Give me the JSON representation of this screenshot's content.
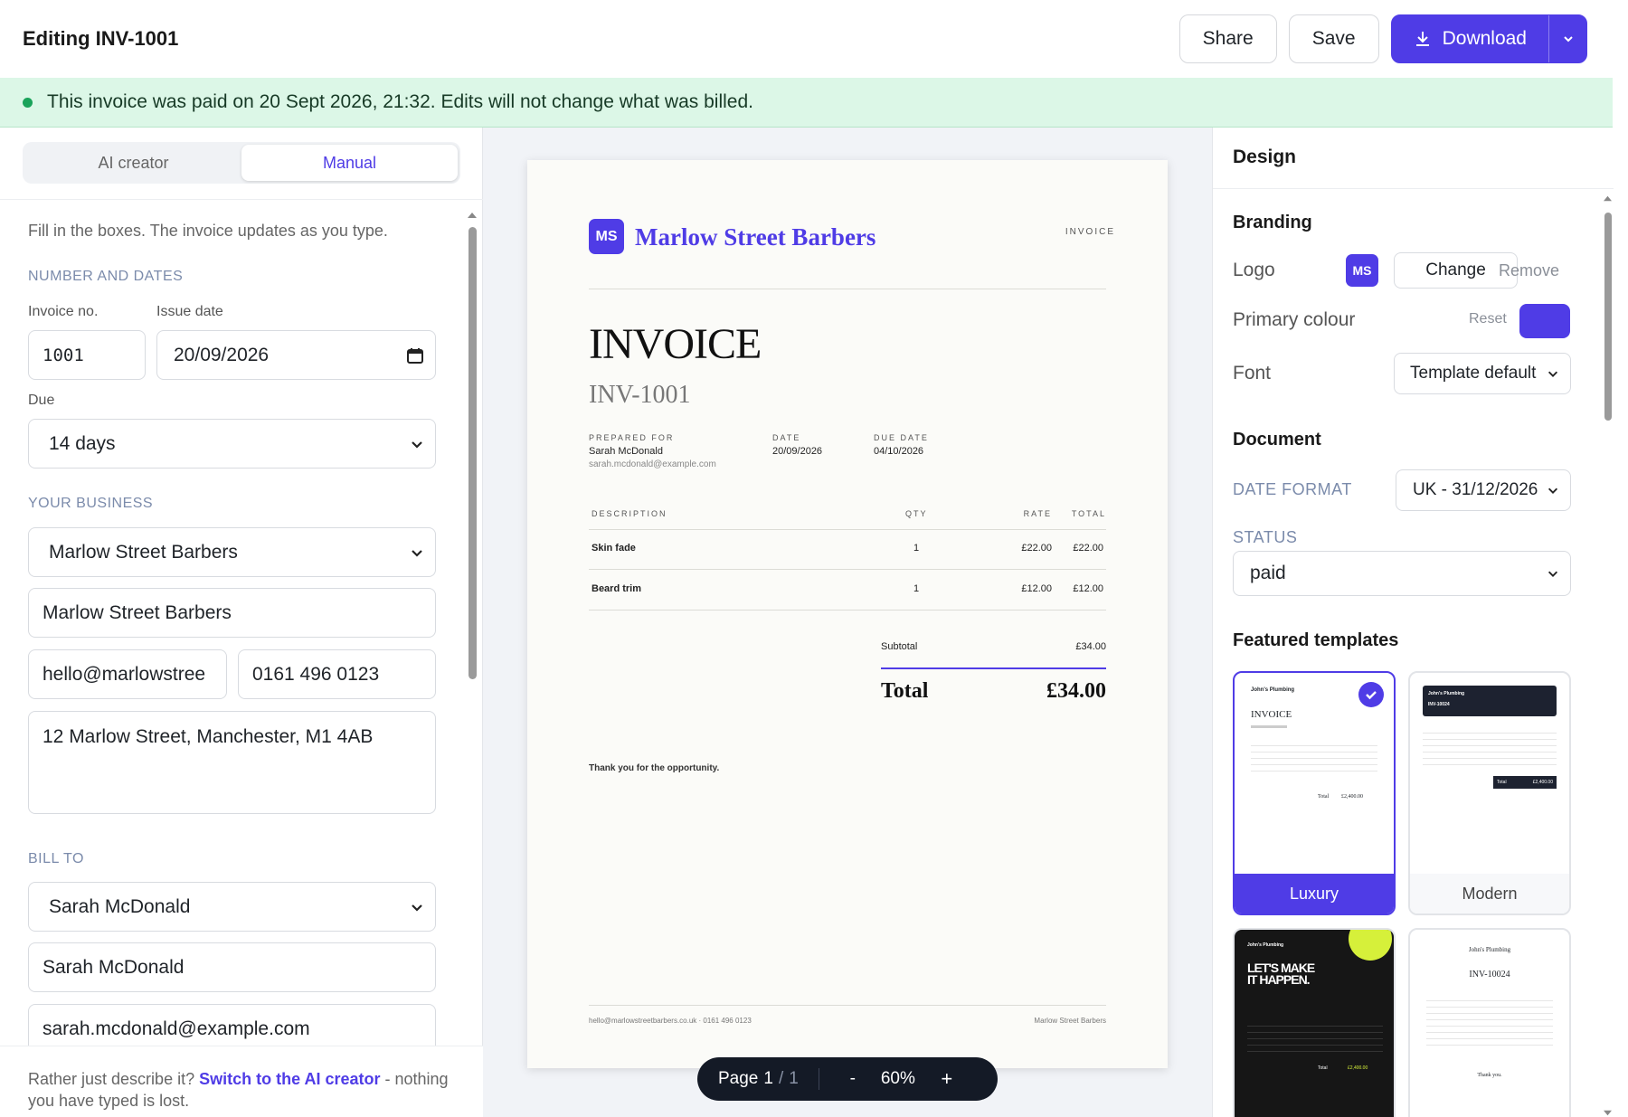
{
  "header": {
    "title": "Editing INV-1001",
    "share": "Share",
    "save": "Save",
    "download": "Download"
  },
  "banner": {
    "text": "This invoice was paid on 20 Sept 2026, 21:32. Edits will not change what was billed.",
    "color": "#1aa35a"
  },
  "tabs": [
    "AI creator",
    "Manual"
  ],
  "form": {
    "hint": "Fill in the boxes. The invoice updates as you type.",
    "section_numbers": "NUMBER AND DATES",
    "invoice_no_label": "Invoice no.",
    "invoice_no": "1001",
    "issue_label": "Issue date",
    "issue_date": "20/09/2026",
    "due_label": "Due",
    "due": "14 days",
    "section_business": "YOUR BUSINESS",
    "business_select": "Marlow Street Barbers",
    "business_name": "Marlow Street Barbers",
    "business_email": "hello@marlowstree",
    "business_phone": "0161 496 0123",
    "business_address": "12 Marlow Street, Manchester, M1 4AB",
    "section_bill": "BILL TO",
    "client_select": "Sarah McDonald",
    "client_name": "Sarah McDonald",
    "client_email": "sarah.mcdonald@example.com"
  },
  "footer_hint": {
    "pre": "Rather just describe it?",
    "link": "Switch to the AI creator",
    "post": "- nothing you have typed is lost."
  },
  "invoice": {
    "logo": "MS",
    "business": "Marlow Street Barbers",
    "label": "INVOICE",
    "heading": "INVOICE",
    "number": "INV-1001",
    "prepared_label": "PREPARED FOR",
    "client": "Sarah McDonald",
    "client_email": "sarah.mcdonald@example.com",
    "date_label": "DATE",
    "date": "20/09/2026",
    "due_label": "DUE DATE",
    "due": "04/10/2026",
    "cols": [
      "DESCRIPTION",
      "QTY",
      "RATE",
      "TOTAL"
    ],
    "items": [
      {
        "desc": "Skin fade",
        "qty": "1",
        "rate": "£22.00",
        "total": "£22.00"
      },
      {
        "desc": "Beard trim",
        "qty": "1",
        "rate": "£12.00",
        "total": "£12.00"
      }
    ],
    "subtotal_label": "Subtotal",
    "subtotal": "£34.00",
    "total_label": "Total",
    "total": "£34.00",
    "thanks": "Thank you for the opportunity.",
    "foot_left": "hello@marlowstreetbarbers.co.uk · 0161 496 0123",
    "foot_right": "Marlow Street Barbers"
  },
  "pager": {
    "label": "Page",
    "page": "1",
    "sep": "/",
    "total": "1",
    "minus": "-",
    "zoom": "60%",
    "plus": "+"
  },
  "design": {
    "title": "Design",
    "branding": "Branding",
    "logo_label": "Logo",
    "logo": "MS",
    "change": "Change",
    "remove": "Remove",
    "primary_label": "Primary colour",
    "reset": "Reset",
    "primary_color": "#4f3ce6",
    "font_label": "Font",
    "font": "Template default",
    "document": "Document",
    "date_format_label": "DATE FORMAT",
    "date_format": "UK - 31/12/2026",
    "status_label": "STATUS",
    "status": "paid",
    "featured": "Featured templates",
    "templates": [
      "Luxury",
      "Modern"
    ],
    "thumb_biz": "John's Plumbing",
    "thumb_invoice": "INVOICE",
    "thumb_num": "INV-10024",
    "thumb_total": "Total",
    "thumb_amount": "£2,400.00",
    "thumb_slogan": "LET'S MAKE IT HAPPEN.",
    "thumb_thanks": "Thank you."
  }
}
